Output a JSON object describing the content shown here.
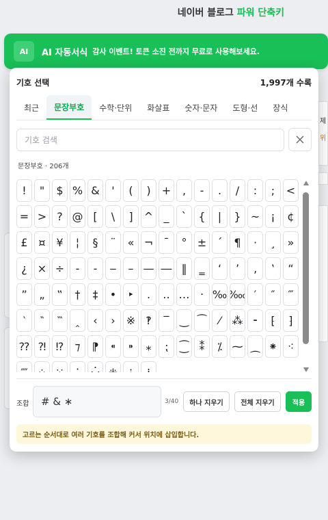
{
  "page": {
    "title_part1": "네이버 블로그",
    "title_part2": "파워 단축키",
    "side_hint_1": "제",
    "side_hint_2": "위"
  },
  "banner": {
    "badge": "AI",
    "title": "AI 자동서식",
    "text": "감사 이벤트! 토큰 소진 전까지 무료로 사용해보세요."
  },
  "panel": {
    "title": "기호 선택",
    "total": "1,997개 수록",
    "tabs": [
      {
        "label": "최근"
      },
      {
        "label": "문장부호"
      },
      {
        "label": "수학·단위"
      },
      {
        "label": "화살표"
      },
      {
        "label": "숫자·문자"
      },
      {
        "label": "도형·선"
      },
      {
        "label": "장식"
      }
    ],
    "active_tab": 1,
    "search_placeholder": "기호 검색",
    "section_label": "문장부호 · 206개",
    "symbols": [
      "!",
      "\"",
      "$",
      "%",
      "&",
      "'",
      "(",
      ")",
      "+",
      ",",
      "-",
      ".",
      "/",
      ":",
      ";",
      "<",
      "=",
      ">",
      "?",
      "@",
      "[",
      "\\",
      "]",
      "^",
      "_",
      "`",
      "{",
      "|",
      "}",
      "~",
      "¡",
      "¢",
      "£",
      "¤",
      "¥",
      "¦",
      "§",
      "¨",
      "«",
      "¬",
      "¯",
      "°",
      "±",
      "´",
      "¶",
      "·",
      "¸",
      "»",
      "¿",
      "×",
      "÷",
      "‐",
      "‑",
      "‒",
      "–",
      "—",
      "―",
      "‖",
      "‗",
      "‘",
      "’",
      "‚",
      "‛",
      "“",
      "”",
      "„",
      "‟",
      "†",
      "‡",
      "•",
      "‣",
      "․",
      "‥",
      "…",
      "‧",
      "‰",
      "‱",
      "′",
      "″",
      "‴",
      "‵",
      "‶",
      "‷",
      "‸",
      "‹",
      "›",
      "※",
      "‽",
      "‾",
      "‿",
      "⁀",
      "⁄",
      "⁂",
      "⁃",
      "⁅",
      "⁆",
      "⁇",
      "⁈",
      "⁉",
      "⁊",
      "⁋",
      "⁌",
      "⁍",
      "⁎",
      "⁏",
      "⁐",
      "⁑",
      "⁒",
      "⁓",
      "⁔",
      "⁕",
      "⁖",
      "⁗",
      "⁘",
      "⁙",
      "⁚",
      "⁛",
      "⁜",
      "⁝",
      "⁞"
    ],
    "combo_label": "조합",
    "combo_value": "# & ∗",
    "combo_count": "3/40",
    "btn_remove_one": "하나 지우기",
    "btn_remove_all": "전체 지우기",
    "btn_apply": "적용",
    "notice": "고르는 순서대로 여러 기호를 조합해 커서 위치에 삽입합니다."
  },
  "colors": {
    "accent": "#19bf57",
    "notice_bg": "#fff7dc"
  }
}
